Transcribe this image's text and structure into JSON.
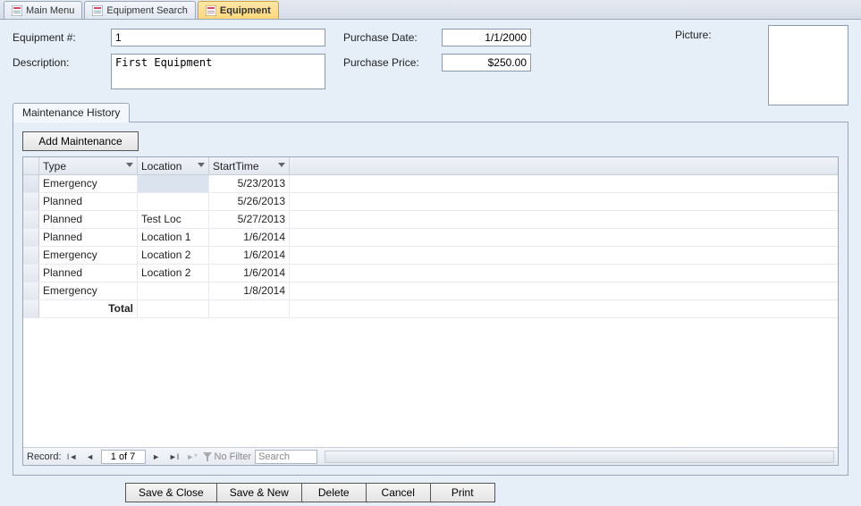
{
  "tabs": [
    {
      "label": "Main Menu",
      "active": false
    },
    {
      "label": "Equipment Search",
      "active": false
    },
    {
      "label": "Equipment",
      "active": true
    }
  ],
  "form": {
    "equipment_num_label": "Equipment #:",
    "equipment_num": "1",
    "description_label": "Description:",
    "description": "First Equipment",
    "purchase_date_label": "Purchase Date:",
    "purchase_date": "1/1/2000",
    "purchase_price_label": "Purchase Price:",
    "purchase_price": "$250.00",
    "picture_label": "Picture:"
  },
  "subform": {
    "tab_label": "Maintenance History",
    "add_button": "Add Maintenance",
    "columns": {
      "type": "Type",
      "location": "Location",
      "starttime": "StartTime"
    },
    "rows": [
      {
        "type": "Emergency",
        "location": "",
        "starttime": "5/23/2013"
      },
      {
        "type": "Planned",
        "location": "",
        "starttime": "5/26/2013"
      },
      {
        "type": "Planned",
        "location": "Test Loc",
        "starttime": "5/27/2013"
      },
      {
        "type": "Planned",
        "location": "Location 1",
        "starttime": "1/6/2014"
      },
      {
        "type": "Emergency",
        "location": "Location 2",
        "starttime": "1/6/2014"
      },
      {
        "type": "Planned",
        "location": "Location 2",
        "starttime": "1/6/2014"
      },
      {
        "type": "Emergency",
        "location": "",
        "starttime": "1/8/2014"
      }
    ],
    "total_label": "Total",
    "nav": {
      "record_label": "Record:",
      "position": "1 of 7",
      "no_filter": "No Filter",
      "search_placeholder": "Search"
    }
  },
  "actions": {
    "save_close": "Save & Close",
    "save_new": "Save & New",
    "delete": "Delete",
    "cancel": "Cancel",
    "print": "Print"
  }
}
